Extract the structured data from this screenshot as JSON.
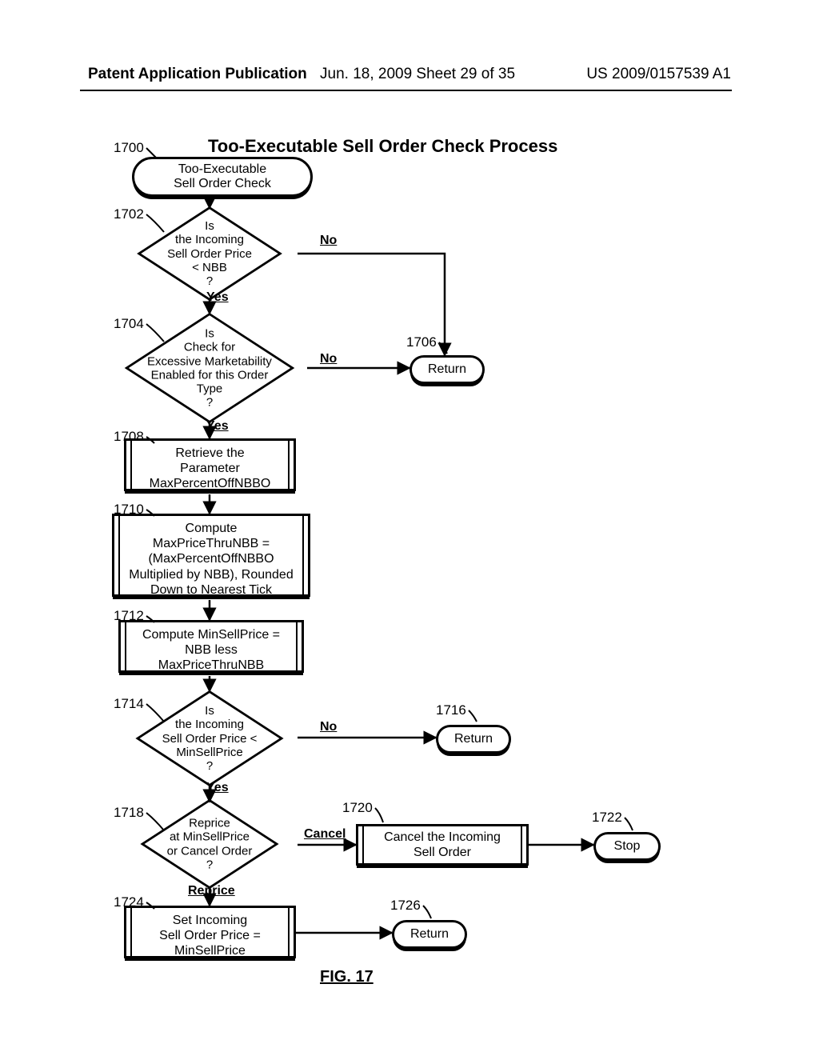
{
  "header": {
    "left": "Patent Application Publication",
    "center": "Jun. 18, 2009  Sheet 29 of 35",
    "right": "US 2009/0157539 A1"
  },
  "title": "Too-Executable Sell Order Check Process",
  "figure_label": "FIG. 17",
  "refs": {
    "r1700": "1700",
    "r1702": "1702",
    "r1704": "1704",
    "r1706": "1706",
    "r1708": "1708",
    "r1710": "1710",
    "r1712": "1712",
    "r1714": "1714",
    "r1716": "1716",
    "r1718": "1718",
    "r1720": "1720",
    "r1722": "1722",
    "r1724": "1724",
    "r1726": "1726"
  },
  "nodes": {
    "n1700": "Too-Executable\nSell Order Check",
    "n1702": "Is\nthe Incoming\nSell Order Price\n< NBB\n?",
    "n1704": "Is\nCheck for\nExcessive Marketability\nEnabled for this Order\nType\n?",
    "n1706": "Return",
    "n1708": "Retrieve the\nParameter\nMaxPercentOffNBBO",
    "n1710": "Compute\nMaxPriceThruNBB =\n(MaxPercentOffNBBO\nMultiplied by NBB), Rounded\nDown to Nearest Tick",
    "n1712": "Compute MinSellPrice =\nNBB less\nMaxPriceThruNBB",
    "n1714": "Is\nthe Incoming\nSell Order Price <\nMinSellPrice\n?",
    "n1716": "Return",
    "n1718": "Reprice\nat MinSellPrice\nor Cancel Order\n?",
    "n1720": "Cancel the Incoming\nSell Order",
    "n1722": "Stop",
    "n1724": "Set Incoming\nSell Order Price =\nMinSellPrice",
    "n1726": "Return"
  },
  "edge_labels": {
    "no": "No",
    "yes": "Yes",
    "cancel": "Cancel",
    "reprice": "Reprice"
  }
}
